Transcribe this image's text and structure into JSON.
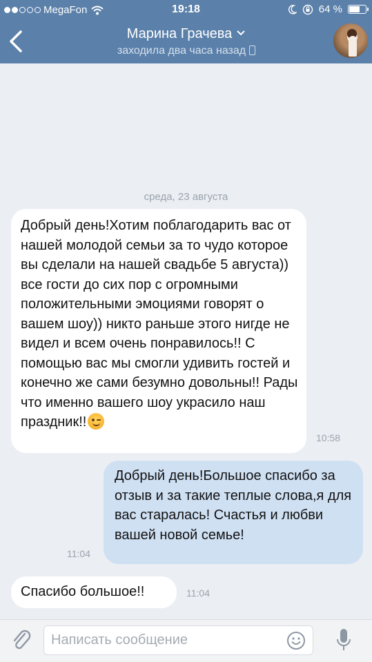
{
  "status_bar": {
    "carrier": "MegaFon",
    "time": "19:18",
    "battery": "64 %",
    "battery_level": 0.64
  },
  "nav": {
    "title": "Марина Грачева",
    "subtitle": "заходила два часа назад"
  },
  "chat": {
    "date_separator": "среда, 23 августа",
    "messages": [
      {
        "direction": "incoming",
        "text": "Добрый день!Хотим поблагодарить вас от нашей молодой семьи за то чудо которое вы сделали на нашей свадьбе 5 августа)) все гости до сих пор с огромными положительными эмоциями говорят о вашем шоу)) никто раньше этого нигде не видел и всем очень понравилось!! С помощью вас мы смогли удивить гостей и конечно же сами безумно довольны!! Рады что именно вашего шоу украсило наш праздник!!",
        "emoji": "winking-face",
        "time": "10:58"
      },
      {
        "direction": "outgoing",
        "text": "Добрый день!Большое спасибо за отзыв и за такие теплые слова,я для вас старалась! Счастья и любви вашей новой семье!",
        "time": "11:04"
      },
      {
        "direction": "incoming",
        "text": "Спасибо большое!!",
        "time": "11:04"
      }
    ]
  },
  "input": {
    "placeholder": "Написать сообщение",
    "value": ""
  },
  "colors": {
    "header": "#5b80aa",
    "background": "#ebeef3",
    "incoming_bubble": "#ffffff",
    "outgoing_bubble": "#cfe0f3"
  }
}
